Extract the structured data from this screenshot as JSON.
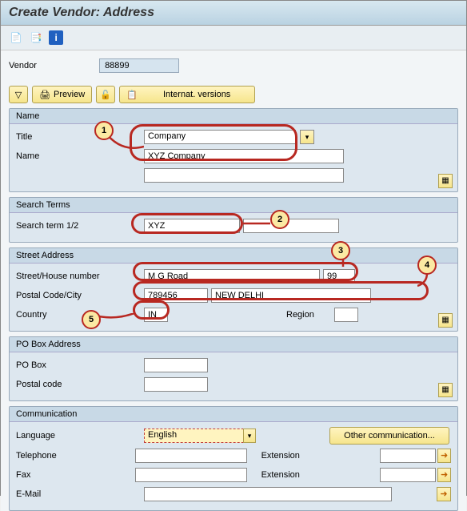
{
  "window_title": "Create Vendor: Address",
  "toolbar_icons": {
    "i1": "page-icon",
    "i2": "copy-icon",
    "i3": "info-icon"
  },
  "vendor": {
    "label": "Vendor",
    "value": "88899"
  },
  "buttons": {
    "expand": "▽",
    "print": "🖨",
    "preview": "Preview",
    "lock": "🔒",
    "copy": "📋",
    "internat": "Internat. versions"
  },
  "panels": {
    "name": {
      "title": "Name",
      "title_lbl": "Title",
      "title_val": "Company",
      "name_lbl": "Name",
      "name_val": "XYZ Company"
    },
    "search": {
      "title": "Search Terms",
      "lbl": "Search term 1/2",
      "val1": "XYZ",
      "val2": ""
    },
    "street": {
      "title": "Street Address",
      "street_lbl": "Street/House number",
      "street_val": "M G Road",
      "house_val": "99",
      "postal_lbl": "Postal Code/City",
      "postal_val": "789456",
      "city_val": "NEW DELHI",
      "country_lbl": "Country",
      "country_val": "IN",
      "region_lbl": "Region",
      "region_val": ""
    },
    "pobox": {
      "title": "PO Box Address",
      "po_lbl": "PO Box",
      "po_val": "",
      "postal_lbl": "Postal code",
      "postal_val": ""
    },
    "comm": {
      "title": "Communication",
      "lang_lbl": "Language",
      "lang_val": "English",
      "other_btn": "Other communication...",
      "tel_lbl": "Telephone",
      "tel_val": "",
      "ext_lbl": "Extension",
      "ext_val": "",
      "fax_lbl": "Fax",
      "fax_val": "",
      "email_lbl": "E-Mail",
      "email_val": ""
    }
  },
  "annotations": {
    "m1": "1",
    "m2": "2",
    "m3": "3",
    "m4": "4",
    "m5": "5"
  }
}
